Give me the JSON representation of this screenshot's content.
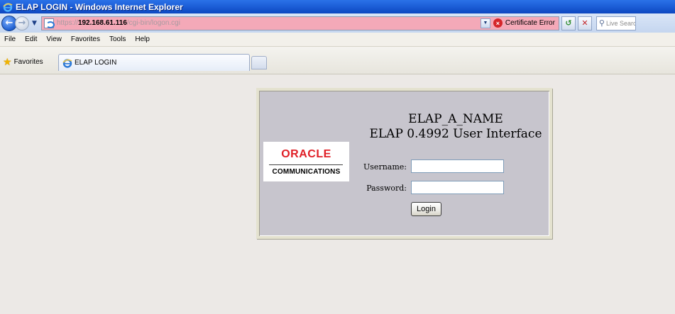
{
  "window": {
    "title": "ELAP LOGIN - Windows Internet Explorer"
  },
  "address_bar": {
    "url_protocol": "https://",
    "url_host": "192.168.61.116",
    "url_path": "/cgi-bin/logon.cgi",
    "certificate_error_label": "Certificate Error",
    "search_placeholder": "Live Search",
    "address_bg_color": "#f4a9b8"
  },
  "menu": {
    "items": [
      "File",
      "Edit",
      "View",
      "Favorites",
      "Tools",
      "Help"
    ]
  },
  "favorites_bar": {
    "favorites_label": "Favorites",
    "active_tab_label": "ELAP LOGIN"
  },
  "login_panel": {
    "title_line1": "ELAP_A_NAME",
    "title_line2": "ELAP 0.4992 User Interface",
    "logo_brand": "ORACLE",
    "logo_sub": "COMMUNICATIONS",
    "username_label": "Username:",
    "username_value": "",
    "password_label": "Password:",
    "password_value": "",
    "login_button": "Login",
    "panel_color": "#c7c5cd",
    "brand_color": "#e01f26"
  },
  "icons": {
    "back": "back-arrow-icon",
    "forward": "forward-arrow-icon",
    "refresh": "refresh-icon",
    "stop": "stop-icon",
    "favorites": "star-icon",
    "certificate": "certificate-error-icon",
    "search": "search-icon",
    "page": "ie-page-icon"
  }
}
